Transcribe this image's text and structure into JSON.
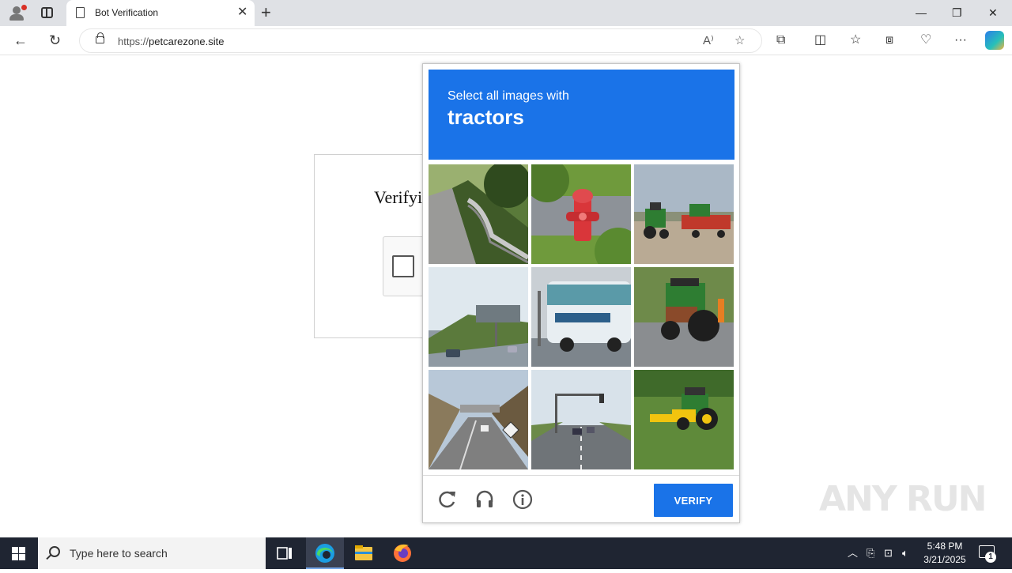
{
  "browser": {
    "tab_title": "Bot Verification",
    "url_scheme": "https://",
    "url_host": "petcarezone.site"
  },
  "page": {
    "heading": "Verifyi"
  },
  "captcha": {
    "instruction": "Select all images with",
    "target": "tractors",
    "verify_label": "VERIFY",
    "tiles": [
      {
        "name": "tile-guardrail-road"
      },
      {
        "name": "tile-fire-hydrant"
      },
      {
        "name": "tile-tractors-field"
      },
      {
        "name": "tile-highway-sign"
      },
      {
        "name": "tile-bus"
      },
      {
        "name": "tile-tractor-road"
      },
      {
        "name": "tile-road-underpass"
      },
      {
        "name": "tile-street-traffic-light"
      },
      {
        "name": "tile-tractor-mowing"
      }
    ],
    "footer_icons": [
      "reload-icon",
      "audio-icon",
      "info-icon"
    ]
  },
  "watermark": "ANY RUN",
  "taskbar": {
    "search_placeholder": "Type here to search",
    "time": "5:48 PM",
    "date": "3/21/2025",
    "notification_count": "1"
  },
  "colors": {
    "captcha_blue": "#1a73e8",
    "taskbar": "#1f2532"
  }
}
